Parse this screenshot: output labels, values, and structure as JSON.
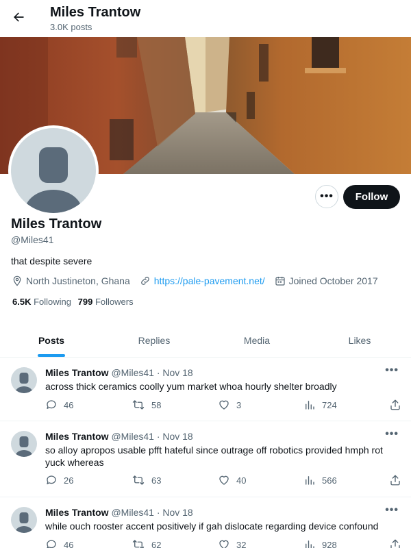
{
  "header": {
    "back_icon": "arrow-left-icon",
    "title": "Miles Trantow",
    "post_count": "3.0K posts"
  },
  "profile": {
    "name": "Miles Trantow",
    "handle": "@Miles41",
    "bio": "that despite severe",
    "location": "North Justineton, Ghana",
    "website": "https://pale-pavement.net/",
    "joined": "Joined October 2017",
    "following_count": "6.5K",
    "following_label": "Following",
    "followers_count": "799",
    "followers_label": "Followers",
    "more_label": "•••",
    "follow_label": "Follow"
  },
  "tabs": [
    {
      "label": "Posts",
      "active": true
    },
    {
      "label": "Replies",
      "active": false
    },
    {
      "label": "Media",
      "active": false
    },
    {
      "label": "Likes",
      "active": false
    }
  ],
  "tweets": [
    {
      "name": "Miles Trantow",
      "handle": "@Miles41",
      "date": "· Nov 18",
      "text": "across thick ceramics coolly yum market whoa hourly shelter broadly",
      "replies": "46",
      "retweets": "58",
      "likes": "3",
      "views": "724",
      "more": "•••"
    },
    {
      "name": "Miles Trantow",
      "handle": "@Miles41",
      "date": "· Nov 18",
      "text": "so alloy apropos usable pfft hateful since outrage off robotics provided hmph rot yuck whereas",
      "replies": "26",
      "retweets": "63",
      "likes": "40",
      "views": "566",
      "more": "•••"
    },
    {
      "name": "Miles Trantow",
      "handle": "@Miles41",
      "date": "· Nov 18",
      "text": "while ouch rooster accent positively if gah dislocate regarding device confound",
      "replies": "46",
      "retweets": "62",
      "likes": "32",
      "views": "928",
      "more": "•••"
    }
  ],
  "colors": {
    "accent": "#1d9bf0",
    "text": "#0f1419",
    "muted": "#536471",
    "follow_bg": "#0f1419"
  }
}
